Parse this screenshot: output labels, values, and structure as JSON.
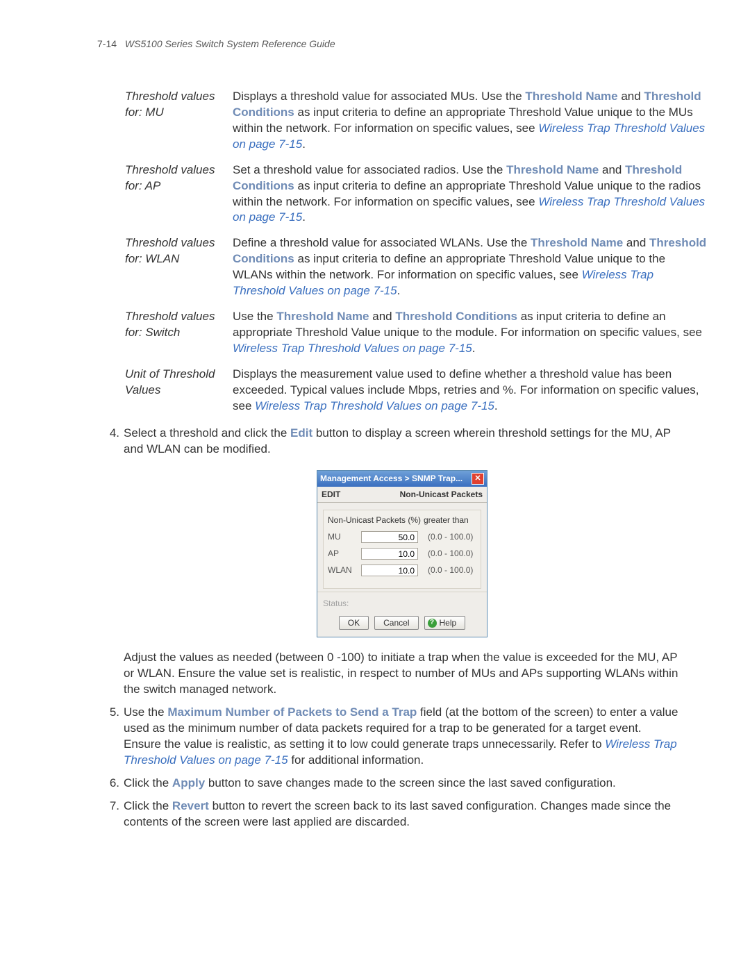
{
  "header": {
    "page_num": "7-14",
    "title": "WS5100 Series Switch System Reference Guide"
  },
  "defs": [
    {
      "term": "Threshold values for: MU",
      "pre": "Displays a threshold value for associated MUs. Use the ",
      "b1": "Threshold Name",
      "mid1": " and ",
      "b2": "Threshold Conditions",
      "post": " as input criteria to define an appropriate Threshold Value unique to the MUs within the network. For information on specific values, see ",
      "xref": "Wireless Trap Threshold Values on page 7-15",
      "end": "."
    },
    {
      "term": "Threshold values for: AP",
      "pre": "Set a threshold value for associated radios. Use the ",
      "b1": "Threshold Name",
      "mid1": " and ",
      "b2": "Threshold Conditions",
      "post": " as input criteria to define an appropriate Threshold Value unique to the radios within the network. For information on specific values, see ",
      "xref": "Wireless Trap Threshold Values on page 7-15",
      "end": "."
    },
    {
      "term": "Threshold values for: WLAN",
      "pre": "Define a threshold value for associated WLANs. Use the ",
      "b1": "Threshold Name",
      "mid1": " and ",
      "b2": "Threshold Conditions",
      "post": " as input criteria to define an appropriate Threshold Value unique to the WLANs within the network. For information on specific values, see ",
      "xref": "Wireless Trap Threshold Values on page 7-15",
      "end": "."
    },
    {
      "term": "Threshold values for: Switch",
      "pre": "Use the ",
      "b1": "Threshold Name",
      "mid1": " and ",
      "b2": "Threshold Conditions",
      "post": " as input criteria to define an appropriate Threshold Value unique to the module. For information on specific values, see ",
      "xref": "Wireless Trap Threshold Values on page 7-15",
      "end": "."
    },
    {
      "term": "Unit of Threshold Values",
      "pre": "Displays the measurement value used to define whether a threshold value has been exceeded. Typical values include Mbps, retries and %. For information on specific values, see ",
      "b1": "",
      "mid1": "",
      "b2": "",
      "post": "",
      "xref": "Wireless Trap Threshold Values on page 7-15",
      "end": "."
    }
  ],
  "steps": {
    "s4": {
      "num": "4.",
      "t1": "Select a threshold and click the ",
      "b1": "Edit",
      "t2": " button to display a screen wherein threshold settings for the MU, AP and WLAN can be modified.",
      "para2": "Adjust the values as needed (between 0 -100) to initiate a trap when the value is exceeded for the MU, AP or WLAN. Ensure the value set is realistic, in respect to number of MUs and APs supporting WLANs within the switch managed network."
    },
    "s5": {
      "num": "5.",
      "t1": "Use the ",
      "b1": "Maximum Number of Packets to Send a Trap",
      "t2": " field (at the bottom of the screen) to enter a value used as the minimum number of data packets required for a trap to be generated for a target event. Ensure the value is realistic, as setting it to low could generate traps unnecessarily. Refer to ",
      "xref": "Wireless Trap Threshold Values on page 7-15",
      "t3": " for additional information."
    },
    "s6": {
      "num": "6.",
      "t1": "Click the ",
      "b1": "Apply",
      "t2": " button to save changes made to the screen since the last saved configuration."
    },
    "s7": {
      "num": "7.",
      "t1": "Click the ",
      "b1": "Revert",
      "t2": " button to revert the screen back to its last saved configuration. Changes made since the contents of the screen were last applied are discarded."
    }
  },
  "dialog": {
    "title": "Management Access > SNMP Trap...",
    "edit_label": "EDIT",
    "section_label": "Non-Unicast Packets",
    "col1": "Non-Unicast Packets (%)",
    "col2": "greater than",
    "rows": [
      {
        "label": "MU",
        "value": "50.0",
        "range": "(0.0 - 100.0)"
      },
      {
        "label": "AP",
        "value": "10.0",
        "range": "(0.0 - 100.0)"
      },
      {
        "label": "WLAN",
        "value": "10.0",
        "range": "(0.0 - 100.0)"
      }
    ],
    "status_label": "Status:",
    "ok": "OK",
    "cancel": "Cancel",
    "help": "Help"
  }
}
